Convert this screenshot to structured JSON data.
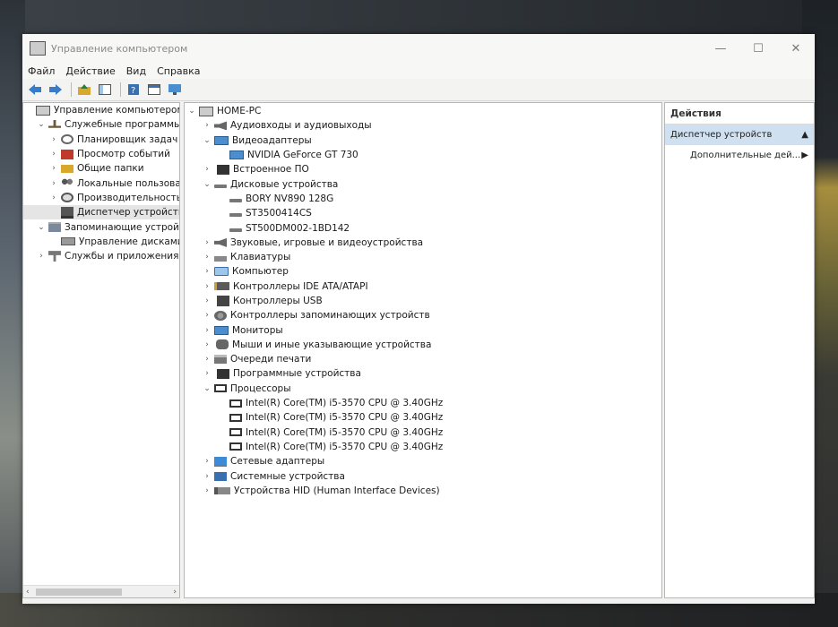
{
  "window": {
    "title": "Управление компьютером",
    "controls": {
      "minimize": "—",
      "maximize": "☐",
      "close": "✕"
    }
  },
  "menu": [
    "Файл",
    "Действие",
    "Вид",
    "Справка"
  ],
  "left_tree": {
    "items": [
      {
        "expander": "",
        "icon": "computer-management-icon",
        "label": "Управление компьютером (л",
        "indent": 0,
        "selected": false
      },
      {
        "expander": "⌄",
        "icon": "tools-icon",
        "label": "Служебные программы",
        "indent": 1,
        "selected": false
      },
      {
        "expander": "›",
        "icon": "clock-icon",
        "label": "Планировщик задач",
        "indent": 2,
        "selected": false
      },
      {
        "expander": "›",
        "icon": "event-log-icon",
        "label": "Просмотр событий",
        "indent": 2,
        "selected": false
      },
      {
        "expander": "›",
        "icon": "shared-folder-icon",
        "label": "Общие папки",
        "indent": 2,
        "selected": false
      },
      {
        "expander": "›",
        "icon": "users-icon",
        "label": "Локальные пользовате",
        "indent": 2,
        "selected": false
      },
      {
        "expander": "›",
        "icon": "performance-icon",
        "label": "Производительность",
        "indent": 2,
        "selected": false
      },
      {
        "expander": "",
        "icon": "device-manager-icon",
        "label": "Диспетчер устройств",
        "indent": 2,
        "selected": true
      },
      {
        "expander": "⌄",
        "icon": "storage-icon",
        "label": "Запоминающие устройст",
        "indent": 1,
        "selected": false
      },
      {
        "expander": "",
        "icon": "disk-management-icon",
        "label": "Управление дисками",
        "indent": 2,
        "selected": false
      },
      {
        "expander": "›",
        "icon": "services-icon",
        "label": "Службы и приложения",
        "indent": 1,
        "selected": false
      }
    ],
    "scroll_left": "‹",
    "scroll_right": "›"
  },
  "device_tree": {
    "items": [
      {
        "expander": "⌄",
        "icon": "computer-icon",
        "label": "HOME-PC",
        "indent": 0
      },
      {
        "expander": "›",
        "icon": "speaker-icon",
        "label": "Аудиовходы и аудиовыходы",
        "indent": 1
      },
      {
        "expander": "⌄",
        "icon": "monitor-icon",
        "label": "Видеоадаптеры",
        "indent": 1
      },
      {
        "expander": "",
        "icon": "monitor-icon",
        "label": "NVIDIA GeForce GT 730",
        "indent": 2
      },
      {
        "expander": "›",
        "icon": "device-icon",
        "label": "Встроенное ПО",
        "indent": 1
      },
      {
        "expander": "⌄",
        "icon": "disk-icon",
        "label": "Дисковые устройства",
        "indent": 1
      },
      {
        "expander": "",
        "icon": "disk-icon",
        "label": "BORY NV890 128G",
        "indent": 2
      },
      {
        "expander": "",
        "icon": "disk-icon",
        "label": "ST3500414CS",
        "indent": 2
      },
      {
        "expander": "",
        "icon": "disk-icon",
        "label": "ST500DM002-1BD142",
        "indent": 2
      },
      {
        "expander": "›",
        "icon": "speaker-icon",
        "label": "Звуковые, игровые и видеоустройства",
        "indent": 1
      },
      {
        "expander": "›",
        "icon": "keyboard-icon",
        "label": "Клавиатуры",
        "indent": 1
      },
      {
        "expander": "›",
        "icon": "pc-icon",
        "label": "Компьютер",
        "indent": 1
      },
      {
        "expander": "›",
        "icon": "ide-icon",
        "label": "Контроллеры IDE ATA/ATAPI",
        "indent": 1
      },
      {
        "expander": "›",
        "icon": "usb-icon",
        "label": "Контроллеры USB",
        "indent": 1
      },
      {
        "expander": "›",
        "icon": "gear-icon",
        "label": "Контроллеры запоминающих устройств",
        "indent": 1
      },
      {
        "expander": "›",
        "icon": "monitor-icon",
        "label": "Мониторы",
        "indent": 1
      },
      {
        "expander": "›",
        "icon": "mouse-icon",
        "label": "Мыши и иные указывающие устройства",
        "indent": 1
      },
      {
        "expander": "›",
        "icon": "printer-icon",
        "label": "Очереди печати",
        "indent": 1
      },
      {
        "expander": "›",
        "icon": "device-icon",
        "label": "Программные устройства",
        "indent": 1
      },
      {
        "expander": "⌄",
        "icon": "processor-icon",
        "label": "Процессоры",
        "indent": 1
      },
      {
        "expander": "",
        "icon": "processor-icon",
        "label": "Intel(R) Core(TM) i5-3570 CPU @ 3.40GHz",
        "indent": 2
      },
      {
        "expander": "",
        "icon": "processor-icon",
        "label": "Intel(R) Core(TM) i5-3570 CPU @ 3.40GHz",
        "indent": 2
      },
      {
        "expander": "",
        "icon": "processor-icon",
        "label": "Intel(R) Core(TM) i5-3570 CPU @ 3.40GHz",
        "indent": 2
      },
      {
        "expander": "",
        "icon": "processor-icon",
        "label": "Intel(R) Core(TM) i5-3570 CPU @ 3.40GHz",
        "indent": 2
      },
      {
        "expander": "›",
        "icon": "network-icon",
        "label": "Сетевые адаптеры",
        "indent": 1
      },
      {
        "expander": "›",
        "icon": "system-icon",
        "label": "Системные устройства",
        "indent": 1
      },
      {
        "expander": "›",
        "icon": "hid-icon",
        "label": "Устройства HID (Human Interface Devices)",
        "indent": 1
      }
    ]
  },
  "actions": {
    "header": "Действия",
    "selected": "Диспетчер устройств",
    "selected_arrow": "▲",
    "item": "Дополнительные дей...",
    "item_arrow": "▶"
  }
}
